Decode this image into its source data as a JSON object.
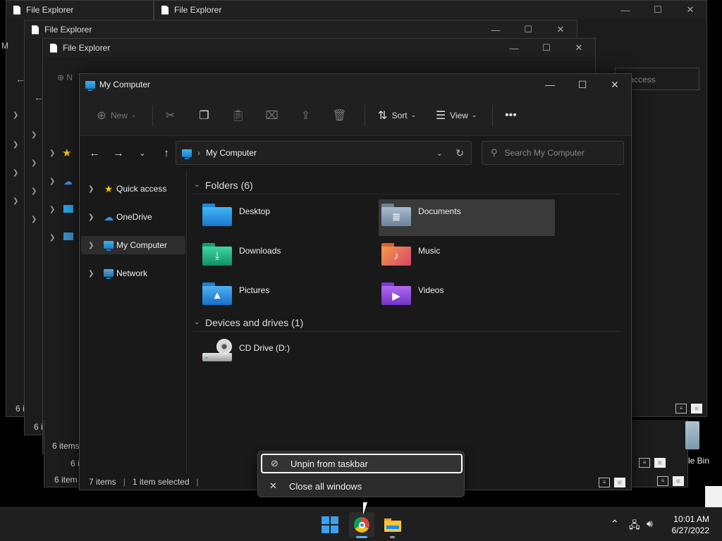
{
  "bg_windows": [
    {
      "title": "File Explorer"
    },
    {
      "title": "File Explorer"
    },
    {
      "title": "File Explorer"
    },
    {
      "title": "File Explorer"
    }
  ],
  "bg_counts": [
    "6 i",
    "6 i",
    "6 items",
    "6 i",
    "6 item"
  ],
  "bg_quick_access": "k access",
  "bg_new_fragment": "N",
  "bg_recycle_label": "le Bin",
  "bg_edge_letter": "M",
  "window": {
    "title": "My Computer",
    "controls": {
      "minimize": "—",
      "maximize": "☐",
      "close": "✕"
    }
  },
  "toolbar": {
    "new_label": "New",
    "sort_label": "Sort",
    "view_label": "View",
    "more_label": "•••"
  },
  "address": {
    "crumb": "My Computer",
    "search_placeholder": "Search My Computer"
  },
  "nav": {
    "items": [
      {
        "label": "Quick access"
      },
      {
        "label": "OneDrive"
      },
      {
        "label": "My Computer"
      },
      {
        "label": "Network"
      }
    ]
  },
  "content": {
    "folders_header": "Folders (6)",
    "folders": [
      {
        "name": "Desktop"
      },
      {
        "name": "Documents"
      },
      {
        "name": "Downloads"
      },
      {
        "name": "Music"
      },
      {
        "name": "Pictures"
      },
      {
        "name": "Videos"
      }
    ],
    "drives_header": "Devices and drives (1)",
    "drives": [
      {
        "name": "CD Drive (D:)"
      }
    ]
  },
  "status": {
    "items": "7 items",
    "selected": "1 item selected"
  },
  "context_menu": {
    "unpin": "Unpin from taskbar",
    "close_all": "Close all windows"
  },
  "taskbar": {
    "time": "10:01 AM",
    "date": "6/27/2022"
  },
  "colors": {
    "accent": "#3aa0f0",
    "selection": "#3a3a3a",
    "window_bg": "#191919"
  }
}
